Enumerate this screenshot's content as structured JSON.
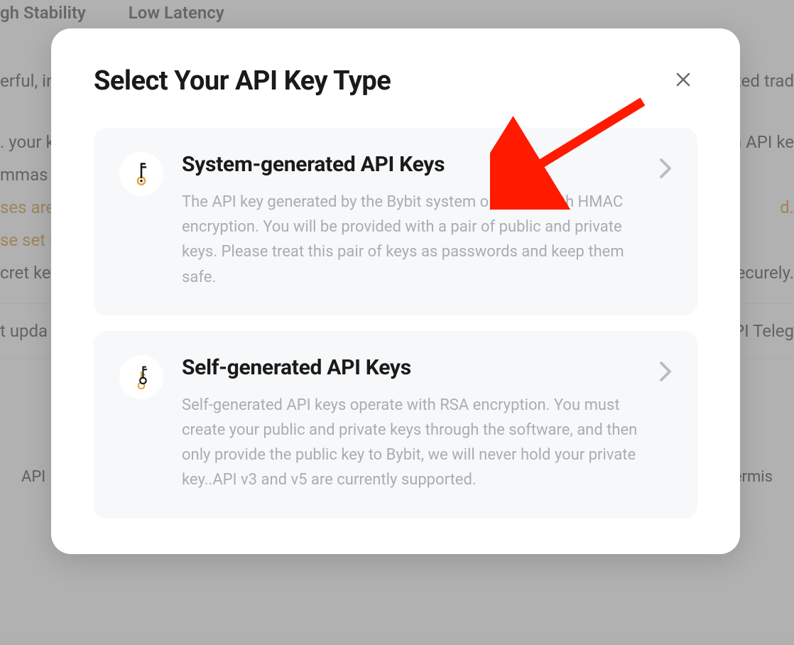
{
  "background": {
    "tab1": "gh Stability",
    "tab2": "Low Latency",
    "line1": "erful, in",
    "line1r": "ated trad",
    "line2": ". your k",
    "line2r": "h API ke",
    "line3": "mmas",
    "warn1": "ses are",
    "warn1r": "d.",
    "warn2": "se set u",
    "line4": "cret ket",
    "line4r": "securely.",
    "upd": "t upda",
    "updr": "API Teleg",
    "footerL": "API",
    "footerR": "Permis"
  },
  "modal": {
    "title": "Select Your API Key Type",
    "options": [
      {
        "title": "System-generated API Keys",
        "desc": "The API key generated by the Bybit system operates with HMAC encryption. You will be provided with a pair of public and private keys. Please treat this pair of keys as passwords and keep them safe."
      },
      {
        "title": "Self-generated API Keys",
        "desc": "Self-generated API keys operate with RSA encryption. You must create your public and private keys through the software, and then only provide the public key to Bybit, we will never hold your private key..API v3 and v5 are currently supported."
      }
    ]
  }
}
